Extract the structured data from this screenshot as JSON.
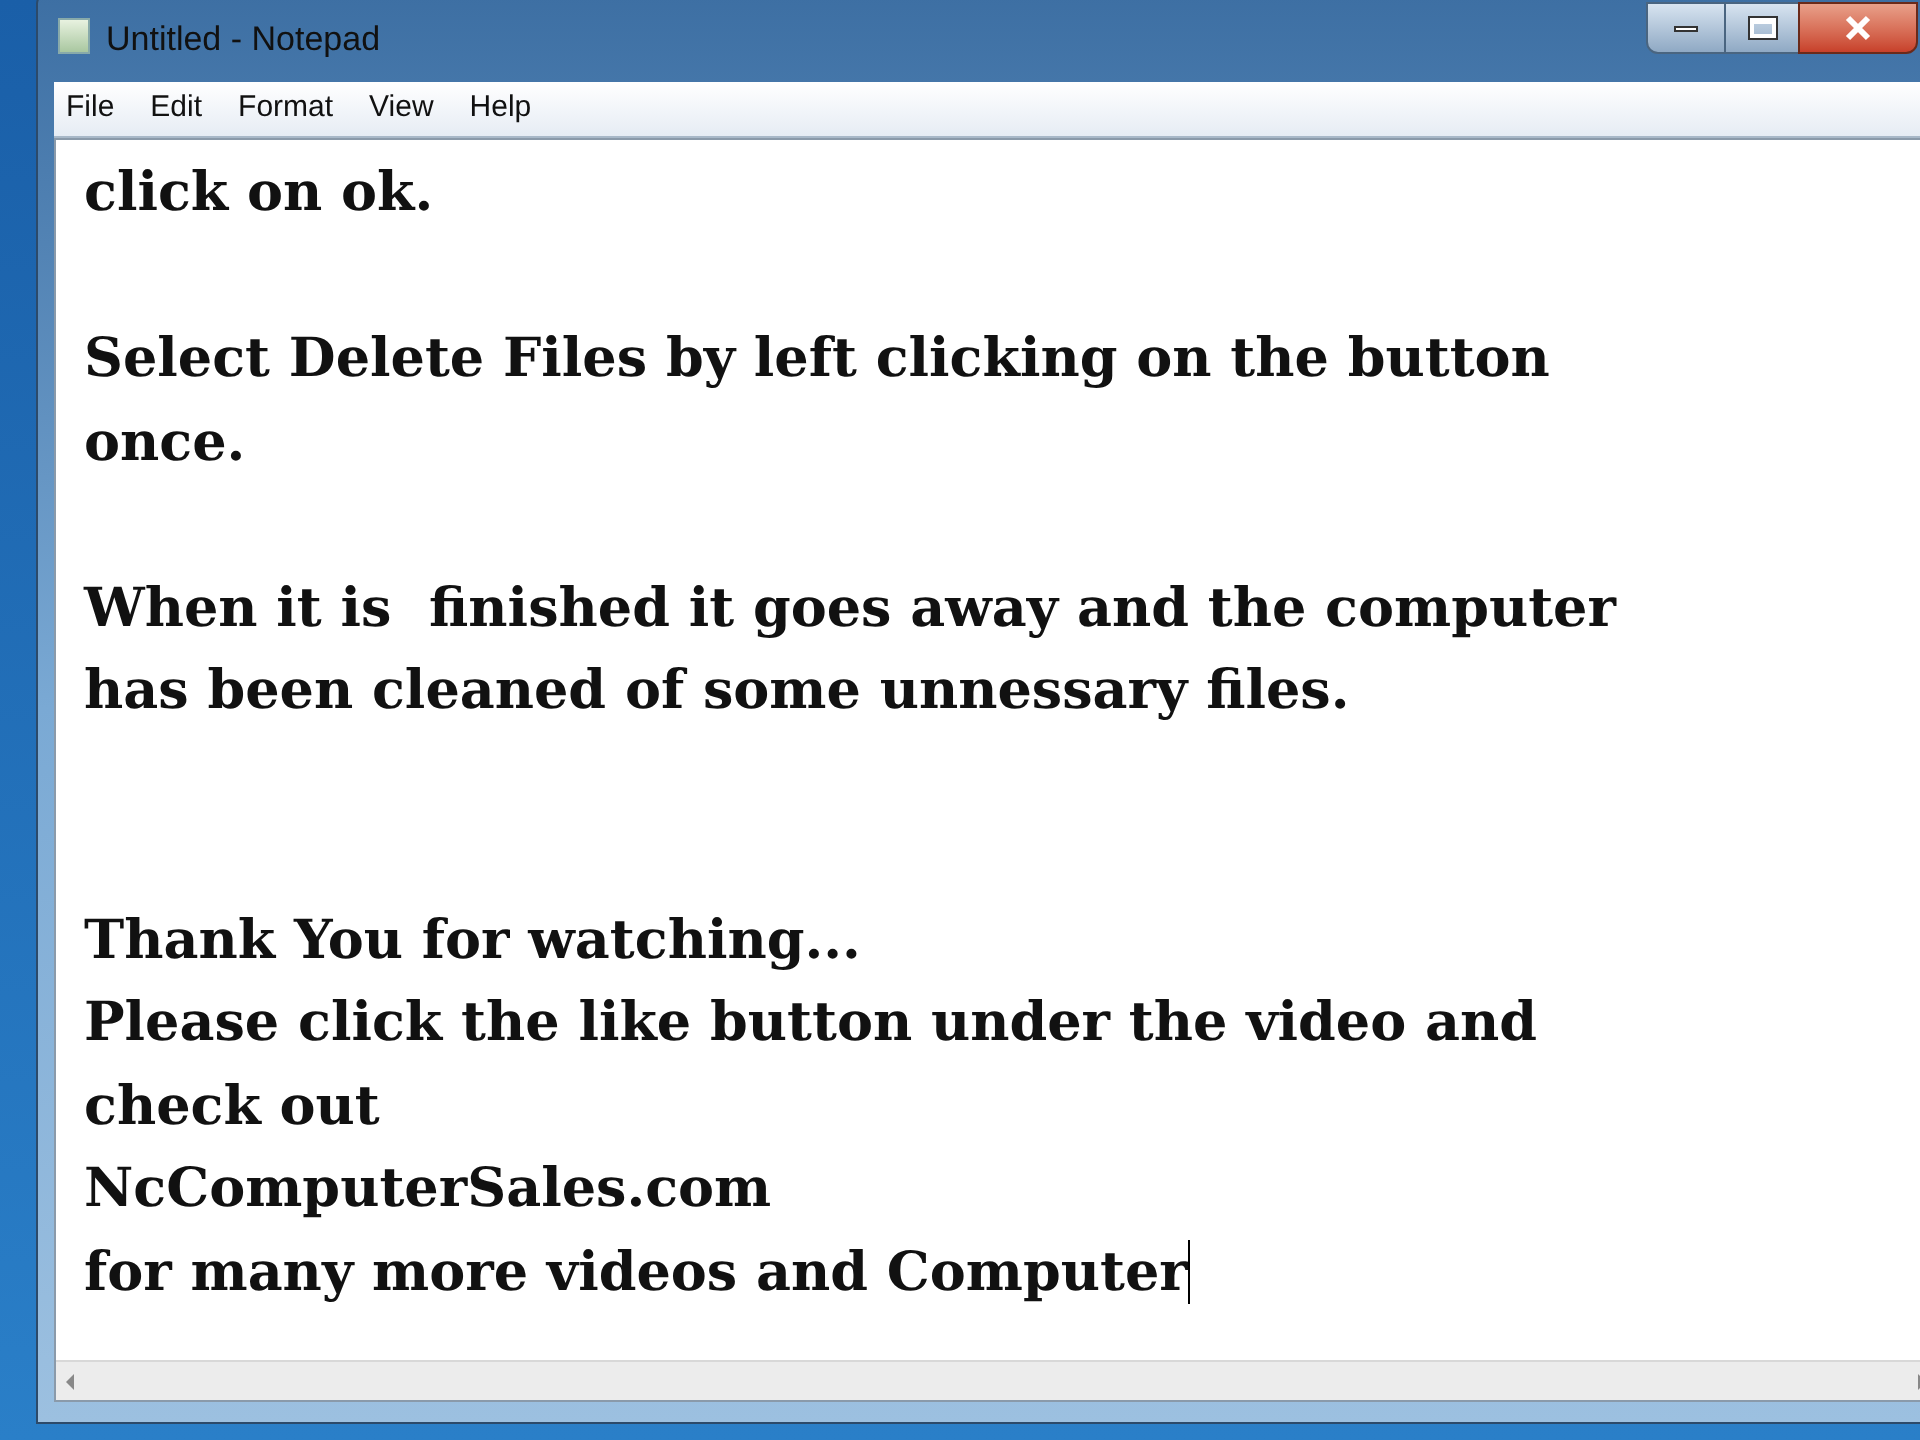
{
  "window": {
    "title": "Untitled - Notepad"
  },
  "menu": [
    "File",
    "Edit",
    "Format",
    "View",
    "Help"
  ],
  "document": {
    "caret": true,
    "lines": [
      {
        "kind": "text",
        "text": "click on ok."
      },
      {
        "kind": "blank"
      },
      {
        "kind": "text",
        "text": "Select Delete Files by left clicking on the button"
      },
      {
        "kind": "text",
        "text": "once."
      },
      {
        "kind": "blank"
      },
      {
        "kind": "text",
        "text": "When it is  finished it goes away and the computer"
      },
      {
        "kind": "text",
        "text": "has been cleaned of some unnessary files."
      },
      {
        "kind": "blank"
      },
      {
        "kind": "blank"
      },
      {
        "kind": "text",
        "text": "Thank You for watching..."
      },
      {
        "kind": "text",
        "text": "Please click the like button under the video and"
      },
      {
        "kind": "text",
        "text": "check out"
      },
      {
        "kind": "text",
        "text": "NcComputerSales.com"
      },
      {
        "kind": "text",
        "text": "for many more videos and Computer"
      }
    ]
  }
}
